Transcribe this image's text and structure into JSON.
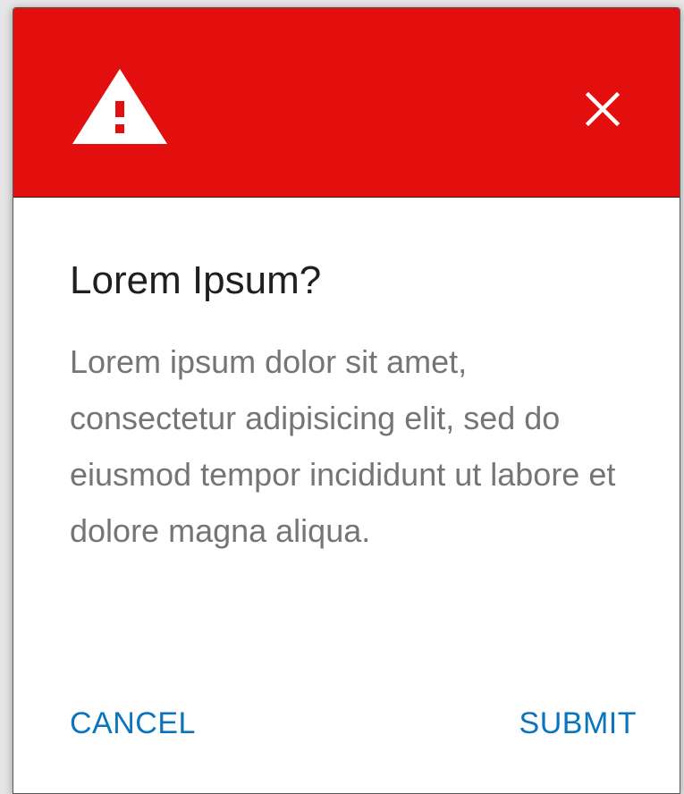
{
  "theme": {
    "header_color": "#e30e0e",
    "action_color": "#0a74bf",
    "icon_color": "#ffffff",
    "icon_mark_color": "#e30e0e"
  },
  "header": {
    "icon": "warning-triangle-icon",
    "close_icon": "close-icon"
  },
  "dialog": {
    "title": "Lorem Ipsum?",
    "body": "Lorem ipsum dolor sit amet, consectetur adipisicing elit, sed do eiusmod tempor incididunt ut labore et dolore magna aliqua."
  },
  "actions": {
    "cancel_label": "CANCEL",
    "submit_label": "SUBMIT"
  }
}
